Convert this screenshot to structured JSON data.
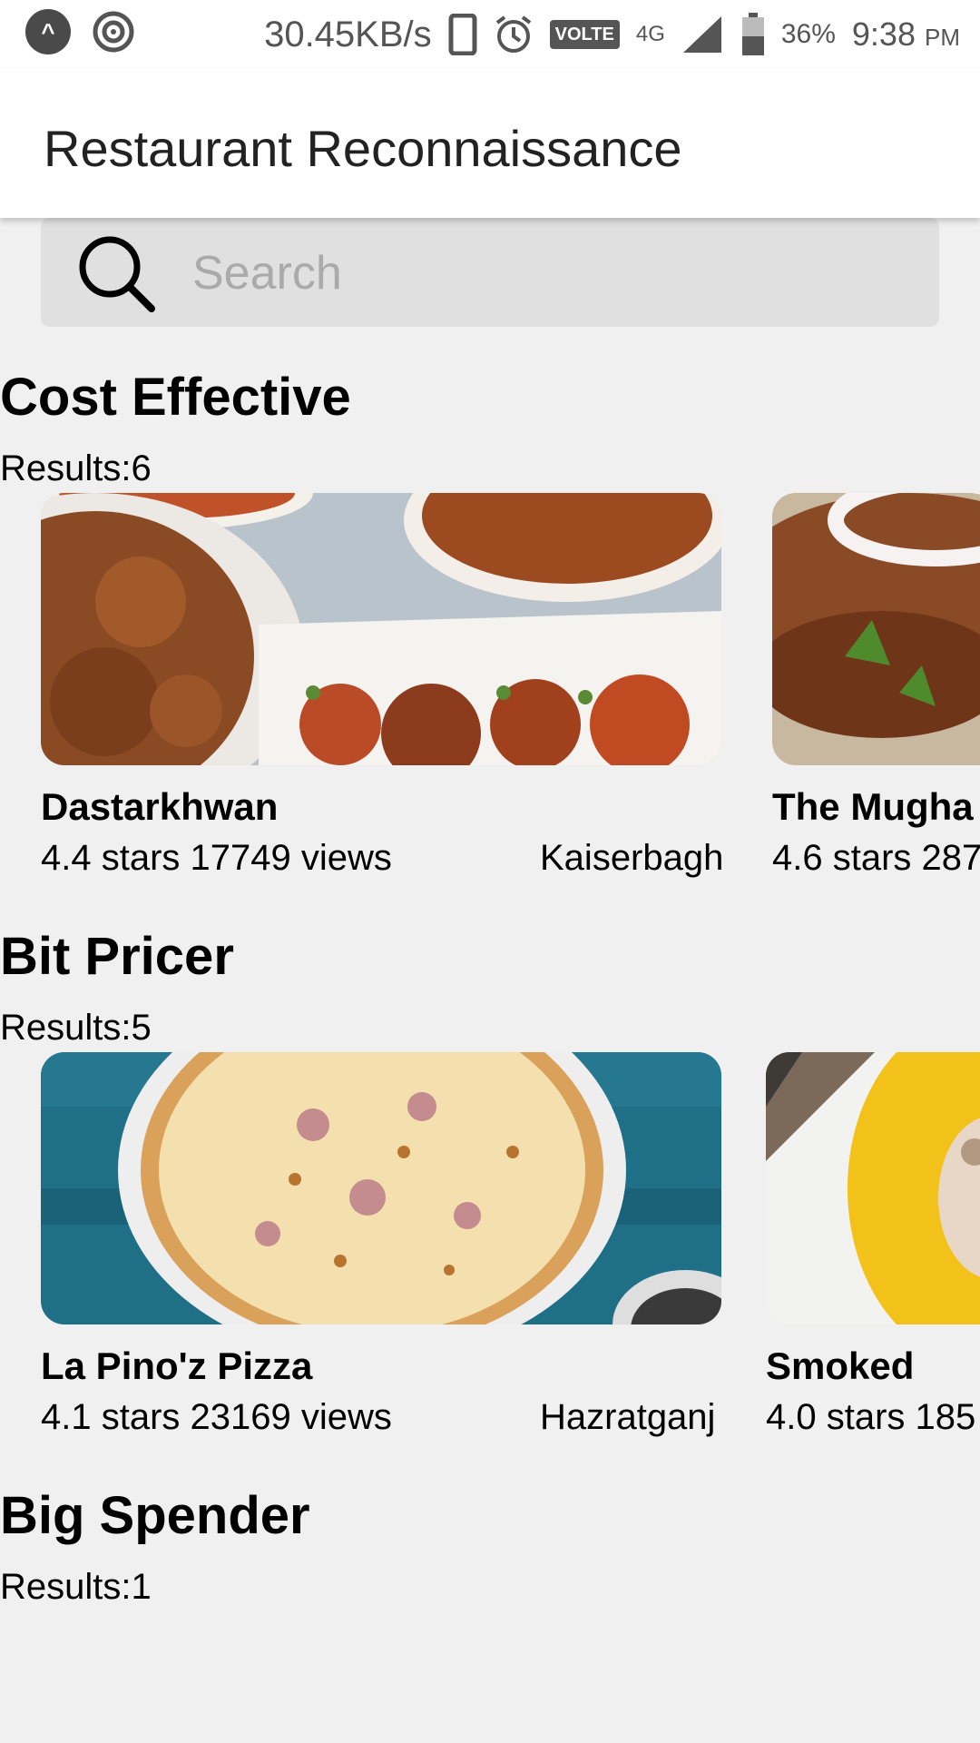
{
  "status_bar": {
    "speed": "30.45KB/s",
    "volte": "VOLTE",
    "network": "4G",
    "battery": "36%",
    "time": "9:38",
    "ampm": "PM"
  },
  "app": {
    "title": "Restaurant Reconnaissance"
  },
  "search": {
    "placeholder": "Search",
    "value": ""
  },
  "sections": [
    {
      "title": "Cost Effective",
      "results": "Results:6",
      "cards": [
        {
          "name": "Dastarkhwan",
          "stats": "4.4 stars 17749 views",
          "location": "Kaiserbagh"
        },
        {
          "name": "The Mugha",
          "stats": "4.6 stars 287"
        }
      ]
    },
    {
      "title": "Bit Pricer",
      "results": "Results:5",
      "cards": [
        {
          "name": "La Pino'z Pizza",
          "stats": "4.1 stars 23169 views",
          "location": "Hazratganj"
        },
        {
          "name": "Smoked",
          "stats": "4.0 stars 185"
        }
      ]
    },
    {
      "title": "Big Spender",
      "results": "Results:1"
    }
  ]
}
